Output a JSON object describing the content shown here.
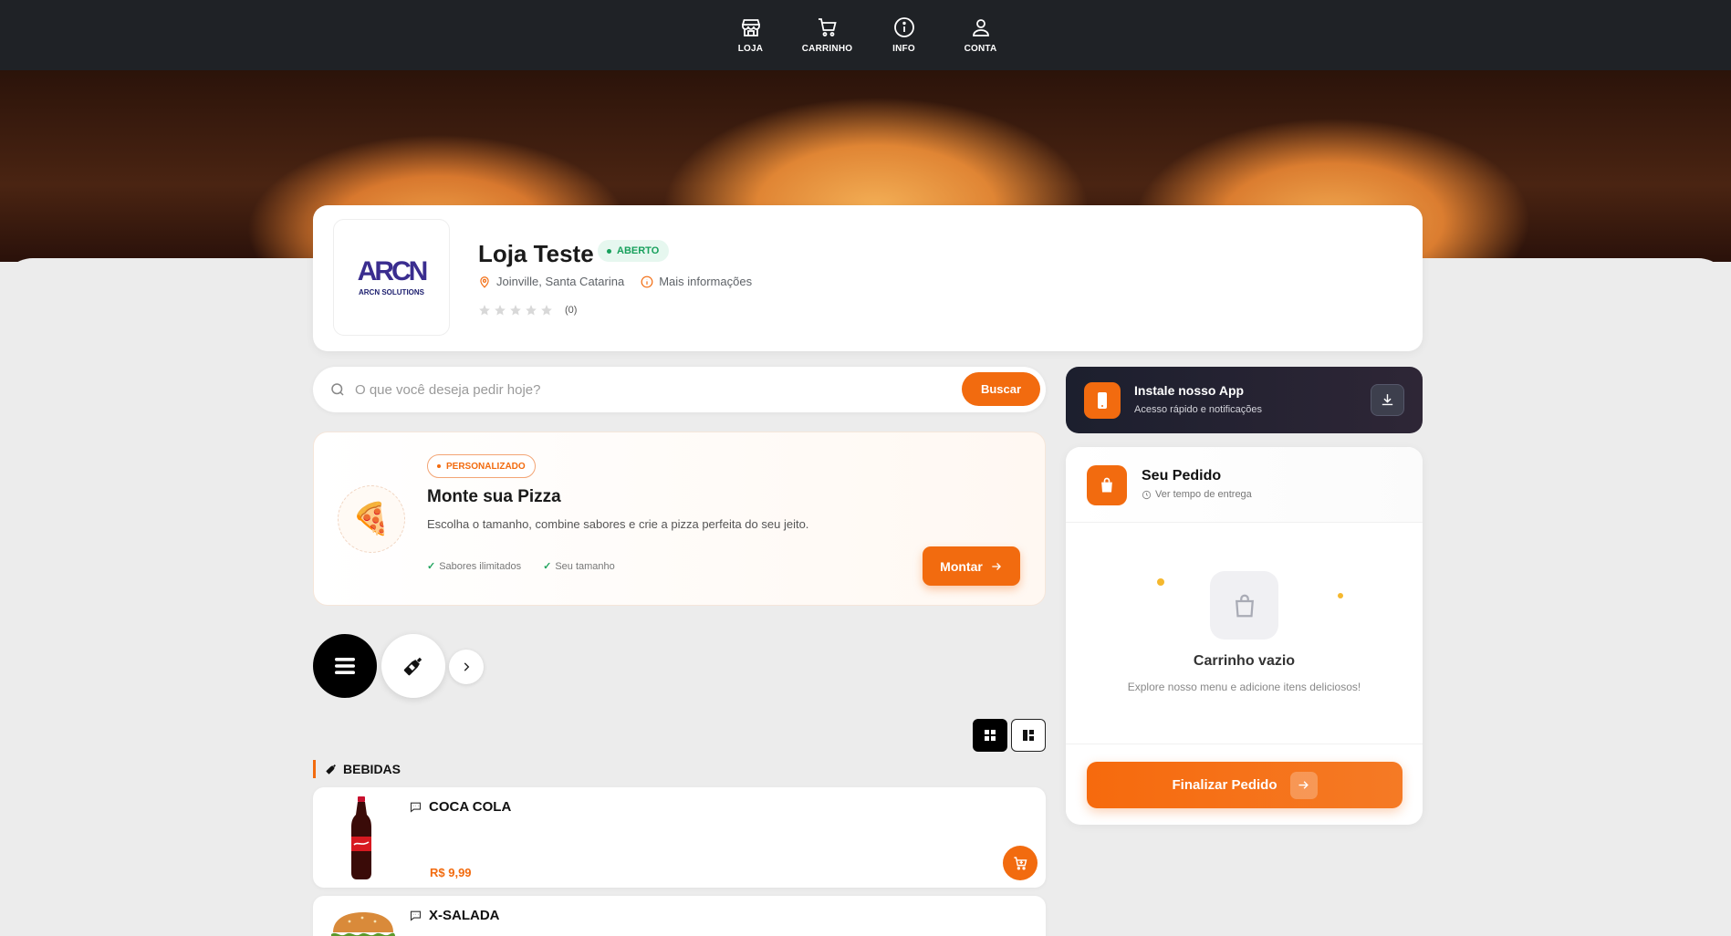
{
  "nav": {
    "items": [
      {
        "label": "LOJA",
        "icon": "store-icon"
      },
      {
        "label": "CARRINHO",
        "icon": "cart-icon"
      },
      {
        "label": "INFO",
        "icon": "info-icon"
      },
      {
        "label": "CONTA",
        "icon": "user-icon"
      }
    ]
  },
  "store": {
    "logo_mark": "ARCN",
    "logo_text": "ARCN SOLUTIONS",
    "name": "Loja Teste",
    "status": "ABERTO",
    "location": "Joinville, Santa Catarina",
    "more_info": "Mais informações",
    "rating_count": "(0)",
    "rating_stars": 0
  },
  "search": {
    "placeholder": "O que você deseja pedir hoje?",
    "button": "Buscar"
  },
  "promo": {
    "badge": "PERSONALIZADO",
    "title": "Monte sua Pizza",
    "description": "Escolha o tamanho, combine sabores e crie a pizza perfeita do seu jeito.",
    "features": [
      "Sabores ilimitados",
      "Seu tamanho"
    ],
    "button": "Montar",
    "icon": "🍕"
  },
  "categories": {
    "section_title": "BEBIDAS"
  },
  "products": [
    {
      "name": "COCA COLA",
      "price": "R$ 9,99"
    },
    {
      "name": "X-SALADA"
    }
  ],
  "app_install": {
    "title": "Instale nosso App",
    "subtitle": "Acesso rápido e notificações"
  },
  "order": {
    "title": "Seu Pedido",
    "subtitle": "Ver tempo de entrega",
    "empty_title": "Carrinho vazio",
    "empty_sub": "Explore nosso menu e adicione itens deliciosos!",
    "checkout": "Finalizar Pedido"
  },
  "colors": {
    "accent": "#f26b0f",
    "nav_bg": "#1f2226",
    "status_green": "#17a05c"
  }
}
